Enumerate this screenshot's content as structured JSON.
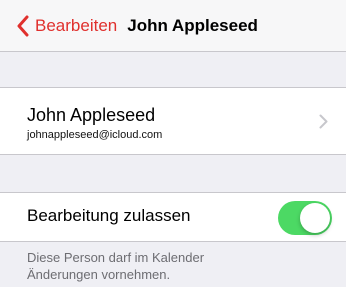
{
  "nav": {
    "back_label": "Bearbeiten",
    "title": "John Appleseed",
    "accent_color": "#e0302d"
  },
  "contact": {
    "name": "John Appleseed",
    "email": "johnappleseed@icloud.com"
  },
  "permission": {
    "label": "Bearbeitung zulassen",
    "enabled": true,
    "toggle_color": "#4cd964",
    "footer_line1": "Diese Person darf im Kalender",
    "footer_line2": "Änderungen vornehmen."
  },
  "icons": {
    "back": "chevron-left-icon",
    "disclosure": "chevron-right-icon"
  }
}
